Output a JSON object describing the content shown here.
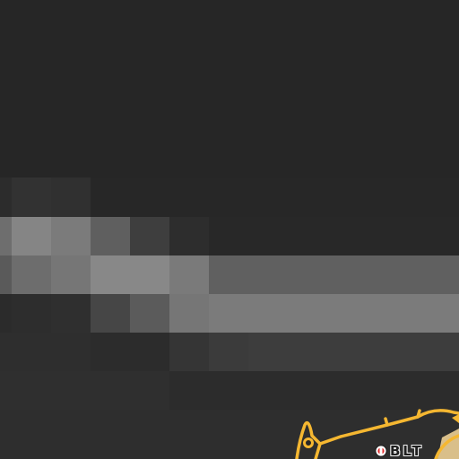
{
  "map": {
    "background_color": "#262626",
    "route_color": "#f5b731",
    "logo": {
      "text": "BLT",
      "mark_colors": [
        "#e02a2a",
        "#ffffff"
      ]
    }
  }
}
